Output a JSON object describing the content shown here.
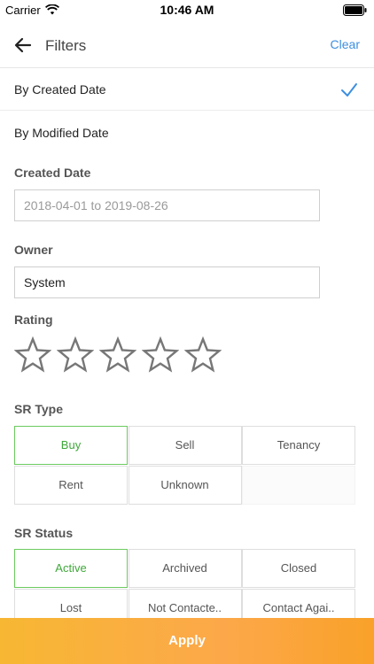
{
  "status_bar": {
    "carrier": "Carrier",
    "time": "10:46 AM"
  },
  "nav": {
    "title": "Filters",
    "clear": "Clear",
    "back_icon": "arrow-left-icon"
  },
  "sort": [
    {
      "label": "By Created Date",
      "selected": true
    },
    {
      "label": "By Modified Date",
      "selected": false
    }
  ],
  "created_date": {
    "label": "Created Date",
    "value": "2018-04-01 to 2019-08-26"
  },
  "owner": {
    "label": "Owner",
    "value": "System"
  },
  "rating": {
    "label": "Rating",
    "value": 0,
    "max": 5
  },
  "sr_type": {
    "label": "SR Type",
    "options": [
      "Buy",
      "Sell",
      "Tenancy",
      "Rent",
      "Unknown"
    ],
    "selected": "Buy"
  },
  "sr_status": {
    "label": "SR Status",
    "options": [
      "Active",
      "Archived",
      "Closed",
      "Lost",
      "Not Contacte..",
      "Contact Agai.."
    ],
    "selected": "Active"
  },
  "apply": "Apply",
  "colors": {
    "accent_blue": "#3d8fe0",
    "selected_green": "#6ccb5f",
    "apply_orange": "#f9a129"
  }
}
